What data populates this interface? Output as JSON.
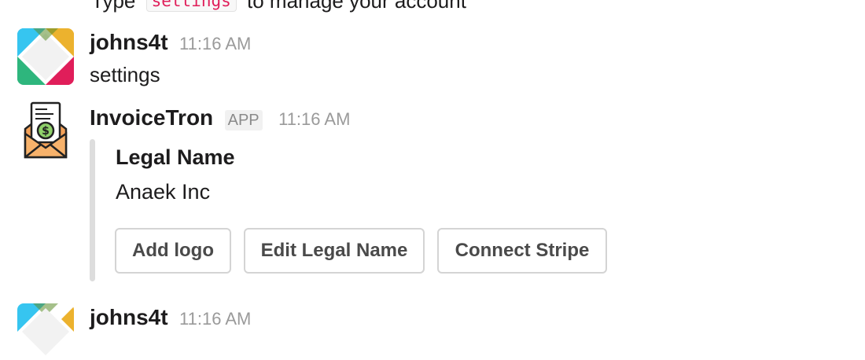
{
  "top_message": {
    "prefix": "Type",
    "code": "settings",
    "suffix": "to manage your account"
  },
  "messages": [
    {
      "author": "johns4t",
      "time": "11:16 AM",
      "text": "settings",
      "avatar_icon": "slack-logo-avatar"
    },
    {
      "author": "InvoiceTron",
      "badge": "APP",
      "time": "11:16 AM",
      "avatar_icon": "invoice-envelope-icon",
      "attachment": {
        "field_title": "Legal Name",
        "field_value": "Anaek Inc",
        "buttons": [
          "Add logo",
          "Edit Legal Name",
          "Connect Stripe"
        ]
      }
    },
    {
      "author": "johns4t",
      "time": "11:16 AM",
      "avatar_icon": "slack-logo-avatar"
    }
  ],
  "colors": {
    "code_text": "#e01e5a",
    "avatar_teal": "#36c5f0",
    "avatar_green": "#2eb67d",
    "avatar_yellow": "#ecb22e",
    "avatar_red": "#e01e5a"
  }
}
